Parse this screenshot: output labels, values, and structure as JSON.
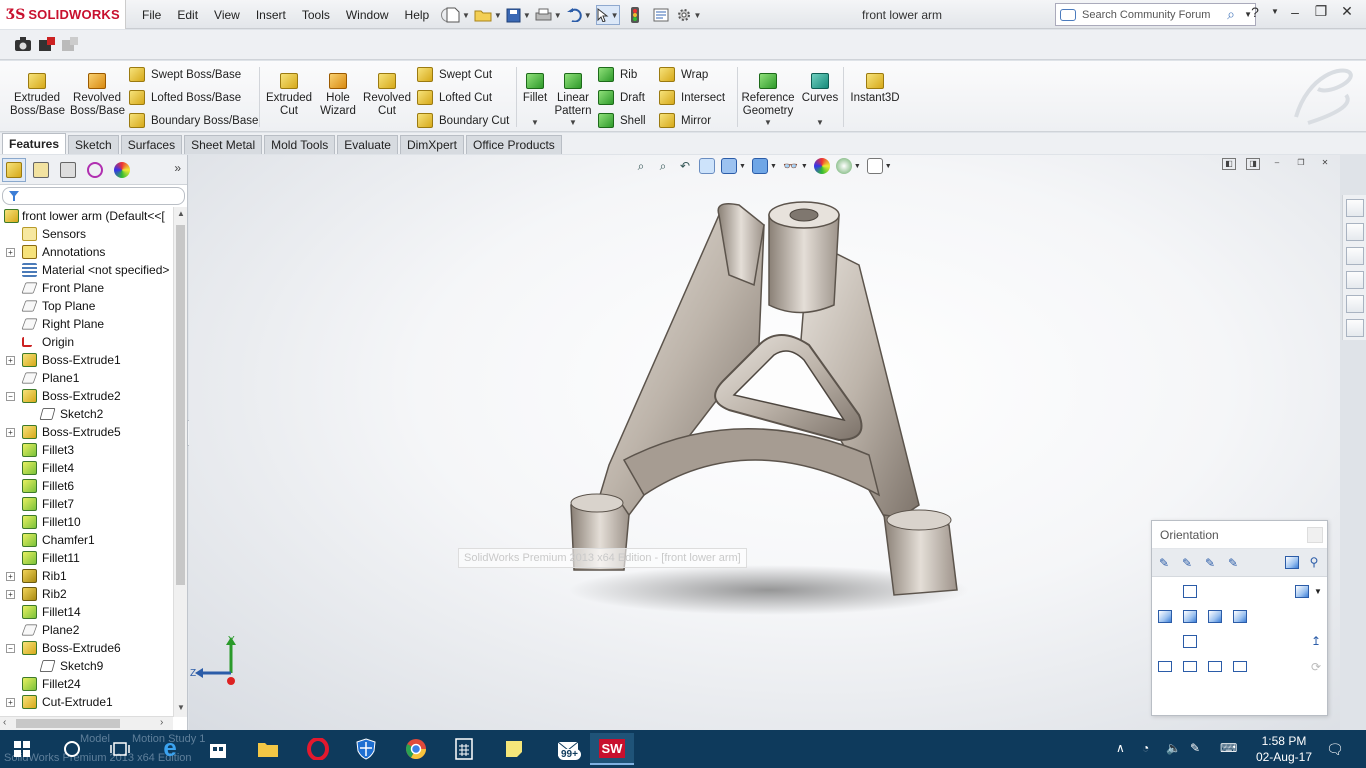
{
  "app": {
    "brand": "SOLIDWORKS",
    "document_title": "front lower arm"
  },
  "menu": [
    "File",
    "Edit",
    "View",
    "Insert",
    "Tools",
    "Window",
    "Help"
  ],
  "search": {
    "placeholder": "Search Community Forum"
  },
  "command_manager": {
    "big": [
      {
        "label1": "Extruded",
        "label2": "Boss/Base"
      },
      {
        "label1": "Revolved",
        "label2": "Boss/Base"
      },
      {
        "label1": "Extruded",
        "label2": "Cut"
      },
      {
        "label1": "Hole",
        "label2": "Wizard"
      },
      {
        "label1": "Revolved",
        "label2": "Cut"
      },
      {
        "label1": "Fillet",
        "label2": ""
      },
      {
        "label1": "Linear",
        "label2": "Pattern"
      },
      {
        "label1": "Reference",
        "label2": "Geometry"
      },
      {
        "label1": "Curves",
        "label2": ""
      },
      {
        "label1": "Instant3D",
        "label2": ""
      }
    ],
    "small": [
      "Swept Boss/Base",
      "Lofted Boss/Base",
      "Boundary Boss/Base",
      "Swept Cut",
      "Lofted Cut",
      "Boundary Cut",
      "Rib",
      "Draft",
      "Shell",
      "Wrap",
      "Intersect",
      "Mirror"
    ]
  },
  "tabs": [
    "Features",
    "Sketch",
    "Surfaces",
    "Sheet Metal",
    "Mold Tools",
    "Evaluate",
    "DimXpert",
    "Office Products"
  ],
  "tree": {
    "root": "front lower arm  (Default<<[",
    "items": [
      {
        "label": "Sensors",
        "icon": "sensor-icon"
      },
      {
        "label": "Annotations",
        "icon": "annotations-icon"
      },
      {
        "label": "Material <not specified>",
        "icon": "material-icon"
      },
      {
        "label": "Front Plane",
        "icon": "plane-icon"
      },
      {
        "label": "Top Plane",
        "icon": "plane-icon"
      },
      {
        "label": "Right Plane",
        "icon": "plane-icon"
      },
      {
        "label": "Origin",
        "icon": "origin-icon"
      },
      {
        "label": "Boss-Extrude1",
        "icon": "extrude-icon"
      },
      {
        "label": "Plane1",
        "icon": "plane-icon"
      },
      {
        "label": "Boss-Extrude2",
        "icon": "extrude-icon"
      },
      {
        "label": "Sketch2",
        "icon": "sketch-icon"
      },
      {
        "label": "Boss-Extrude5",
        "icon": "extrude-icon"
      },
      {
        "label": "Fillet3",
        "icon": "fillet-icon"
      },
      {
        "label": "Fillet4",
        "icon": "fillet-icon"
      },
      {
        "label": "Fillet6",
        "icon": "fillet-icon"
      },
      {
        "label": "Fillet7",
        "icon": "fillet-icon"
      },
      {
        "label": "Fillet10",
        "icon": "fillet-icon"
      },
      {
        "label": "Chamfer1",
        "icon": "chamfer-icon"
      },
      {
        "label": "Fillet11",
        "icon": "fillet-icon"
      },
      {
        "label": "Rib1",
        "icon": "rib-icon"
      },
      {
        "label": "Rib2",
        "icon": "rib-icon"
      },
      {
        "label": "Fillet14",
        "icon": "fillet-icon"
      },
      {
        "label": "Plane2",
        "icon": "plane-icon"
      },
      {
        "label": "Boss-Extrude6",
        "icon": "extrude-icon"
      },
      {
        "label": "Sketch9",
        "icon": "sketch-icon"
      },
      {
        "label": "Fillet24",
        "icon": "fillet-icon"
      },
      {
        "label": "Cut-Extrude1",
        "icon": "cut-extrude-icon"
      }
    ]
  },
  "viewport": {
    "ghost_status": "SolidWorks Premium 2013 x64 Edition - [front lower arm]",
    "triad_y": "Y",
    "triad_z": "Z"
  },
  "orientation": {
    "title": "Orientation"
  },
  "statusbar": {
    "text": "SolidWorks Premium 2013 x64 Edition",
    "model_tab": "Model",
    "motion_tab": "Motion Study 1"
  },
  "taskbar": {
    "time": "1:58 PM",
    "date": "02-Aug-17",
    "badge": "99+"
  },
  "colors": {
    "brand_red": "#c8102e",
    "taskbar": "#0e3a5c",
    "accent_blue": "#3d7ed6"
  }
}
